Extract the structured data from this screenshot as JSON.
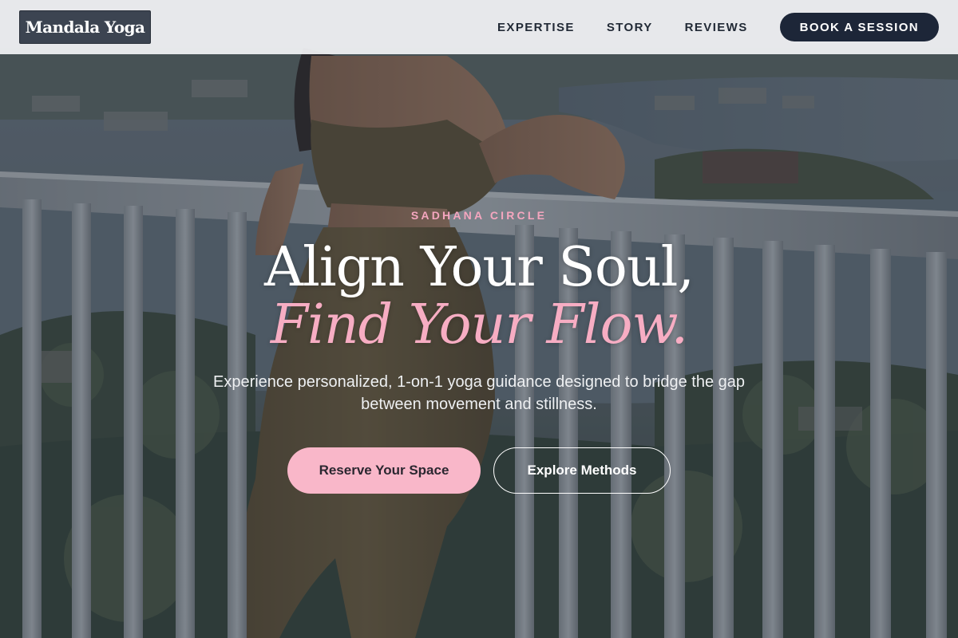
{
  "brand": {
    "logo_text": "Mandala Yoga"
  },
  "nav": {
    "items": [
      {
        "label": "EXPERTISE"
      },
      {
        "label": "STORY"
      },
      {
        "label": "REVIEWS"
      }
    ],
    "cta_label": "BOOK A SESSION"
  },
  "hero": {
    "eyebrow": "SADHANA CIRCLE",
    "headline_line1": "Align Your Soul,",
    "headline_line2": "Find Your Flow.",
    "subtext": "Experience personalized, 1-on-1 yoga guidance designed to bridge the gap between movement and stillness.",
    "primary_button": "Reserve Your Space",
    "secondary_button": "Explore Methods",
    "background_image": "woman-leaning-on-railing-photo"
  },
  "colors": {
    "accent_pink": "#f9b7c9",
    "navy": "#1d2638",
    "header_bg": "#f2f3f5"
  }
}
